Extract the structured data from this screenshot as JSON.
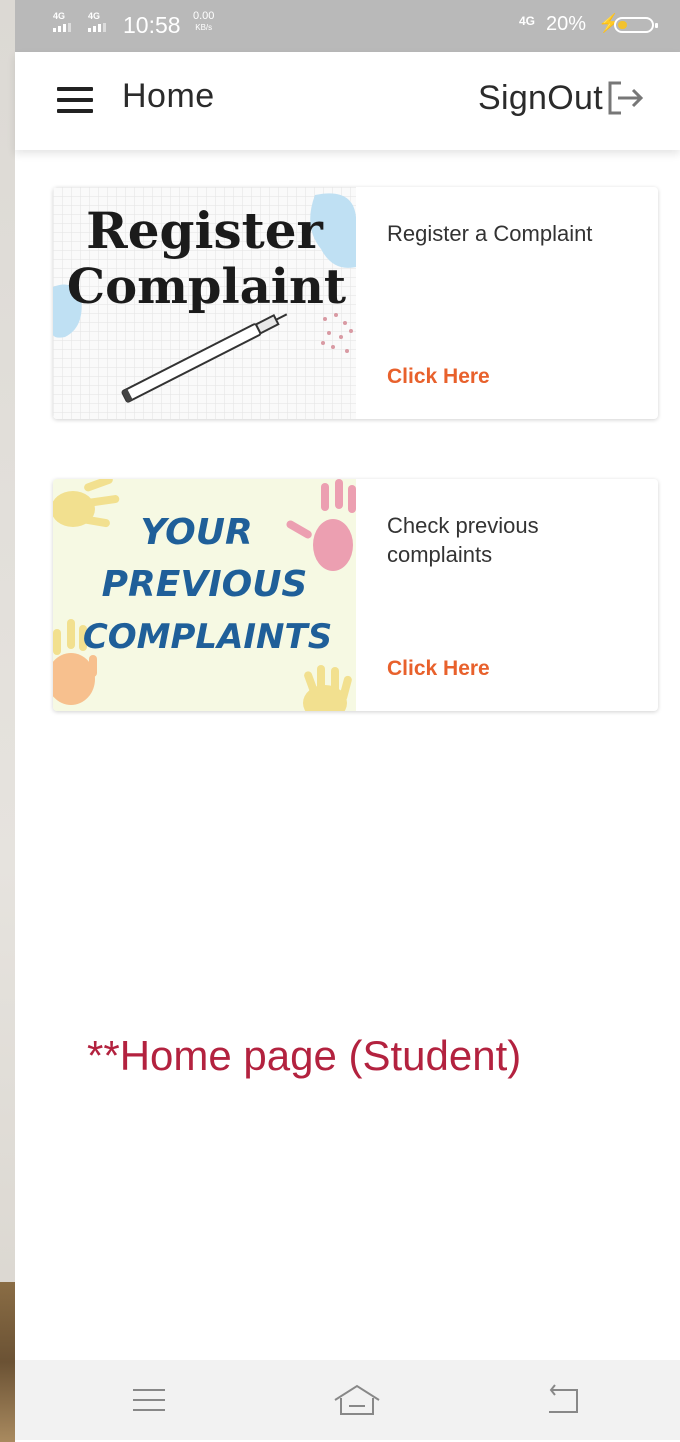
{
  "status_bar": {
    "signal_1": "4G",
    "signal_2": "4G",
    "time": "10:58",
    "speed_value": "0.00",
    "speed_unit": "KB/s",
    "network": "4G",
    "battery_percent": "20%",
    "battery_level": 0.2,
    "battery_fill_color": "#f2c230"
  },
  "header": {
    "menu_icon": "hamburger-menu-icon",
    "title": "Home",
    "signout_label": "SignOut",
    "signout_icon": "exit-arrow-icon"
  },
  "cards": [
    {
      "image_line_1": "Register",
      "image_line_2": "Complaint",
      "text": "Register a Complaint",
      "link": "Click Here"
    },
    {
      "image_line_1": "YOUR",
      "image_line_2": "PREVIOUS",
      "image_line_3": "COMPLAINTS",
      "text": "Check previous complaints",
      "link": "Click Here"
    }
  ],
  "caption": "**Home page (Student)",
  "nav_bar": {
    "menu_icon": "menu-lines-icon",
    "home_icon": "home-icon",
    "back_icon": "back-icon"
  },
  "colors": {
    "accent": "#e8612c",
    "caption": "#b3223f",
    "status_bar": "#b9b9b9",
    "previous_text": "#1f5f99"
  }
}
